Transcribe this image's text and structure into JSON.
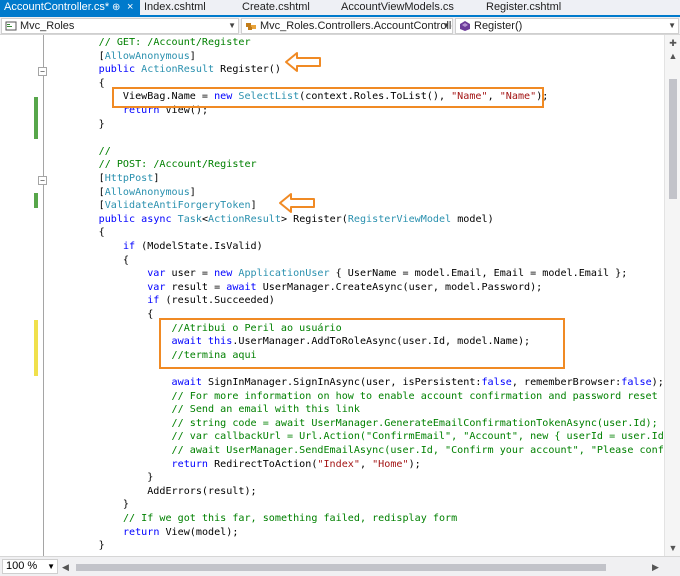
{
  "tabs": [
    {
      "label": "AccountController.cs*",
      "active": true,
      "pin": "⊕",
      "close": "×"
    },
    {
      "label": "Index.cshtml"
    },
    {
      "label": "Create.cshtml"
    },
    {
      "label": "AccountViewModels.cs"
    },
    {
      "label": "Register.cshtml"
    }
  ],
  "nav": {
    "project": "Mvc_Roles",
    "class": "Mvc_Roles.Controllers.AccountController",
    "member": "Register()"
  },
  "zoom": "100 %",
  "colors": {
    "accent": "#007acc",
    "highlight_box": "#f08a24",
    "keyword": "#0000ff",
    "type": "#2b91af",
    "string": "#a31515",
    "comment": "#008000"
  },
  "code_lines": [
    [
      {
        "t": "        "
      },
      {
        "t": "// GET: /Account/Register",
        "c": "cm"
      }
    ],
    [
      {
        "t": "        "
      },
      {
        "t": "["
      },
      {
        "t": "AllowAnonymous",
        "c": "ty"
      },
      {
        "t": "]"
      }
    ],
    [
      {
        "t": "        "
      },
      {
        "t": "public",
        "c": "kw"
      },
      {
        "t": " "
      },
      {
        "t": "ActionResult",
        "c": "ty"
      },
      {
        "t": " Register()"
      }
    ],
    [
      {
        "t": "        {"
      }
    ],
    [
      {
        "t": "            ViewBag.Name = "
      },
      {
        "t": "new",
        "c": "kw"
      },
      {
        "t": " "
      },
      {
        "t": "SelectList",
        "c": "ty"
      },
      {
        "t": "(context.Roles.ToList(), "
      },
      {
        "t": "\"Name\"",
        "c": "st"
      },
      {
        "t": ", "
      },
      {
        "t": "\"Name\"",
        "c": "st"
      },
      {
        "t": ");"
      }
    ],
    [
      {
        "t": "            "
      },
      {
        "t": "return",
        "c": "kw"
      },
      {
        "t": " View();"
      }
    ],
    [
      {
        "t": "        }"
      }
    ],
    [
      {
        "t": ""
      }
    ],
    [
      {
        "t": "        "
      },
      {
        "t": "//",
        "c": "cm"
      }
    ],
    [
      {
        "t": "        "
      },
      {
        "t": "// POST: /Account/Register",
        "c": "cm"
      }
    ],
    [
      {
        "t": "        "
      },
      {
        "t": "["
      },
      {
        "t": "HttpPost",
        "c": "ty"
      },
      {
        "t": "]"
      }
    ],
    [
      {
        "t": "        "
      },
      {
        "t": "["
      },
      {
        "t": "AllowAnonymous",
        "c": "ty"
      },
      {
        "t": "]"
      }
    ],
    [
      {
        "t": "        "
      },
      {
        "t": "["
      },
      {
        "t": "ValidateAntiForgeryToken",
        "c": "ty"
      },
      {
        "t": "]"
      }
    ],
    [
      {
        "t": "        "
      },
      {
        "t": "public",
        "c": "kw"
      },
      {
        "t": " "
      },
      {
        "t": "async",
        "c": "kw"
      },
      {
        "t": " "
      },
      {
        "t": "Task",
        "c": "ty"
      },
      {
        "t": "<"
      },
      {
        "t": "ActionResult",
        "c": "ty"
      },
      {
        "t": "> Register("
      },
      {
        "t": "RegisterViewModel",
        "c": "ty"
      },
      {
        "t": " model)"
      }
    ],
    [
      {
        "t": "        {"
      }
    ],
    [
      {
        "t": "            "
      },
      {
        "t": "if",
        "c": "kw"
      },
      {
        "t": " (ModelState.IsValid)"
      }
    ],
    [
      {
        "t": "            {"
      }
    ],
    [
      {
        "t": "                "
      },
      {
        "t": "var",
        "c": "kw"
      },
      {
        "t": " user = "
      },
      {
        "t": "new",
        "c": "kw"
      },
      {
        "t": " "
      },
      {
        "t": "ApplicationUser",
        "c": "ty"
      },
      {
        "t": " { UserName = model.Email, Email = model.Email };"
      }
    ],
    [
      {
        "t": "                "
      },
      {
        "t": "var",
        "c": "kw"
      },
      {
        "t": " result = "
      },
      {
        "t": "await",
        "c": "kw"
      },
      {
        "t": " UserManager.CreateAsync(user, model.Password);"
      }
    ],
    [
      {
        "t": "                "
      },
      {
        "t": "if",
        "c": "kw"
      },
      {
        "t": " (result.Succeeded)"
      }
    ],
    [
      {
        "t": "                {"
      }
    ],
    [
      {
        "t": "                    "
      },
      {
        "t": "//Atribui o Peril ao usuário",
        "c": "cm"
      }
    ],
    [
      {
        "t": "                    "
      },
      {
        "t": "await",
        "c": "kw"
      },
      {
        "t": " "
      },
      {
        "t": "this",
        "c": "kw"
      },
      {
        "t": ".UserManager.AddToRoleAsync(user.Id, model.Name);"
      }
    ],
    [
      {
        "t": "                    "
      },
      {
        "t": "//termina aqui",
        "c": "cm"
      }
    ],
    [
      {
        "t": ""
      }
    ],
    [
      {
        "t": "                    "
      },
      {
        "t": "await",
        "c": "kw"
      },
      {
        "t": " SignInManager.SignInAsync(user, isPersistent:"
      },
      {
        "t": "false",
        "c": "kw"
      },
      {
        "t": ", rememberBrowser:"
      },
      {
        "t": "false",
        "c": "kw"
      },
      {
        "t": ");"
      }
    ],
    [
      {
        "t": "                    "
      },
      {
        "t": "// For more information on how to enable account confirmation and password reset pl",
        "c": "cm"
      }
    ],
    [
      {
        "t": "                    "
      },
      {
        "t": "// Send an email with this link",
        "c": "cm"
      }
    ],
    [
      {
        "t": "                    "
      },
      {
        "t": "// string code = await UserManager.GenerateEmailConfirmationTokenAsync(user.Id);",
        "c": "cm"
      }
    ],
    [
      {
        "t": "                    "
      },
      {
        "t": "// var callbackUrl = Url.Action(\"ConfirmEmail\", \"Account\", new { userId = user.Id,",
        "c": "cm"
      }
    ],
    [
      {
        "t": "                    "
      },
      {
        "t": "// await UserManager.SendEmailAsync(user.Id, \"Confirm your account\", \"Please confir",
        "c": "cm"
      }
    ],
    [
      {
        "t": "                    "
      },
      {
        "t": "return",
        "c": "kw"
      },
      {
        "t": " RedirectToAction("
      },
      {
        "t": "\"Index\"",
        "c": "st"
      },
      {
        "t": ", "
      },
      {
        "t": "\"Home\"",
        "c": "st"
      },
      {
        "t": ");"
      }
    ],
    [
      {
        "t": "                }"
      }
    ],
    [
      {
        "t": "                AddErrors(result);"
      }
    ],
    [
      {
        "t": "            }"
      }
    ],
    [
      {
        "t": "            "
      },
      {
        "t": "// If we got this far, something failed, redisplay form",
        "c": "cm"
      }
    ],
    [
      {
        "t": "            "
      },
      {
        "t": "return",
        "c": "kw"
      },
      {
        "t": " View(model);"
      }
    ],
    [
      {
        "t": "        }"
      }
    ]
  ]
}
